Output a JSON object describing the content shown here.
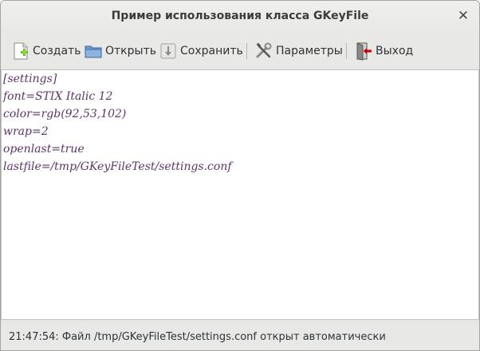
{
  "window": {
    "title": "Пример использования класса GKeyFile",
    "close_glyph": "✕"
  },
  "toolbar": {
    "buttons": [
      {
        "label": "Создать",
        "icon": "new-document-icon"
      },
      {
        "label": "Открыть",
        "icon": "folder-icon"
      },
      {
        "label": "Сохранить",
        "icon": "save-arrow-icon"
      },
      {
        "label": "Параметры",
        "icon": "tools-icon"
      },
      {
        "label": "Выход",
        "icon": "exit-icon"
      }
    ]
  },
  "editor": {
    "lines": [
      "[settings]",
      "font=STIX Italic 12",
      "color=rgb(92,53,102)",
      "wrap=2",
      "openlast=true",
      "lastfile=/tmp/GKeyFileTest/settings.conf"
    ],
    "text_color": "#5c3566"
  },
  "statusbar": {
    "text": "21:47:54: Файл /tmp/GKeyFileTest/settings.conf открыт автоматически"
  }
}
